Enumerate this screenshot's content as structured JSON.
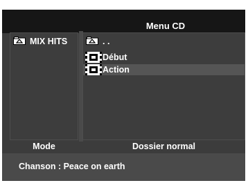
{
  "header": {
    "title": "Menu CD"
  },
  "left_panel": {
    "items": [
      {
        "icon": "folder-icon",
        "label": "MIX HITS"
      }
    ]
  },
  "right_panel": {
    "items": [
      {
        "icon": "folder-icon",
        "label": ". ."
      },
      {
        "icon": "track-icon",
        "label": "Début"
      },
      {
        "icon": "track-icon",
        "label": "Action",
        "selected": true
      }
    ]
  },
  "bottom_bar": {
    "mode_label": "Mode",
    "folder_mode_label": "Dossier normal"
  },
  "status": {
    "text": "Chanson : Peace on earth"
  },
  "colors": {
    "background": "#3c3c3c",
    "header": "#161616",
    "highlight": "#555555",
    "text": "#ffffff"
  }
}
